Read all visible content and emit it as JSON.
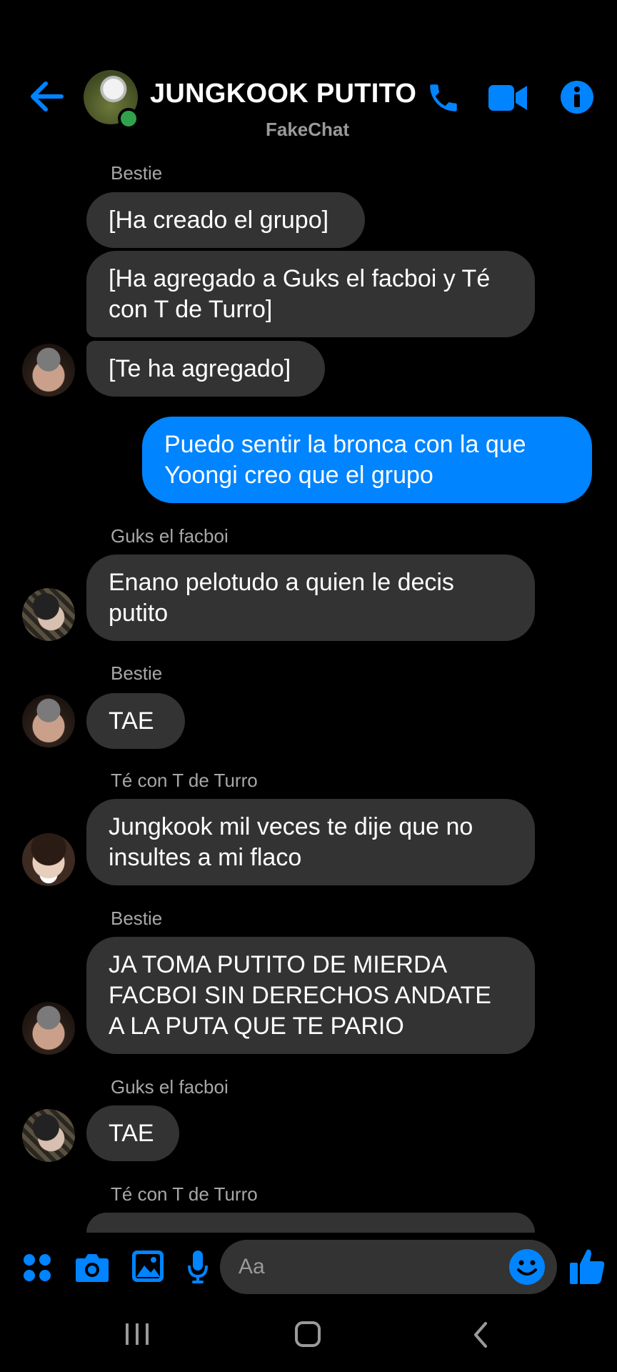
{
  "header": {
    "title": "JUNGKOOK PUTITO",
    "subtitle": "FakeChat",
    "icons": [
      "back-arrow-icon",
      "phone-icon",
      "video-camera-icon",
      "info-icon"
    ]
  },
  "messages": [
    {
      "sender": "Bestie",
      "bubbles": [
        "[Ha creado el grupo]",
        "[Ha agregado a Guks el facboi y Té con T de Turro]",
        "[Te ha agregado]"
      ]
    },
    {
      "me": true,
      "bubbles": [
        "Puedo sentir la bronca con la que Yoongi creo que el grupo"
      ]
    },
    {
      "sender": "Guks el facboi",
      "bubbles": [
        "Enano pelotudo a quien le decis putito"
      ]
    },
    {
      "sender": "Bestie",
      "bubbles": [
        "TAE"
      ]
    },
    {
      "sender": "Té con T de Turro",
      "bubbles": [
        "Jungkook mil veces te dije que no insultes a mi flaco"
      ]
    },
    {
      "sender": "Bestie",
      "bubbles": [
        "JA TOMA PUTITO DE MIERDA FACBOI SIN DERECHOS ANDATE A LA PUTA QUE TE PARIO"
      ]
    },
    {
      "sender": "Guks el facboi",
      "bubbles": [
        "TAE"
      ]
    },
    {
      "sender": "Té con T de Turro",
      "bubbles": []
    }
  ],
  "composer": {
    "placeholder": "Aa",
    "icons": [
      "apps-grid-icon",
      "camera-icon",
      "gallery-icon",
      "microphone-icon",
      "emoji-icon",
      "thumbs-up-icon"
    ]
  },
  "navbar": {
    "icons": [
      "recent-apps-icon",
      "home-icon",
      "back-icon"
    ]
  },
  "colors": {
    "accent": "#0084ff",
    "bubble": "#333333",
    "background": "#000000",
    "online": "#31a24c"
  }
}
